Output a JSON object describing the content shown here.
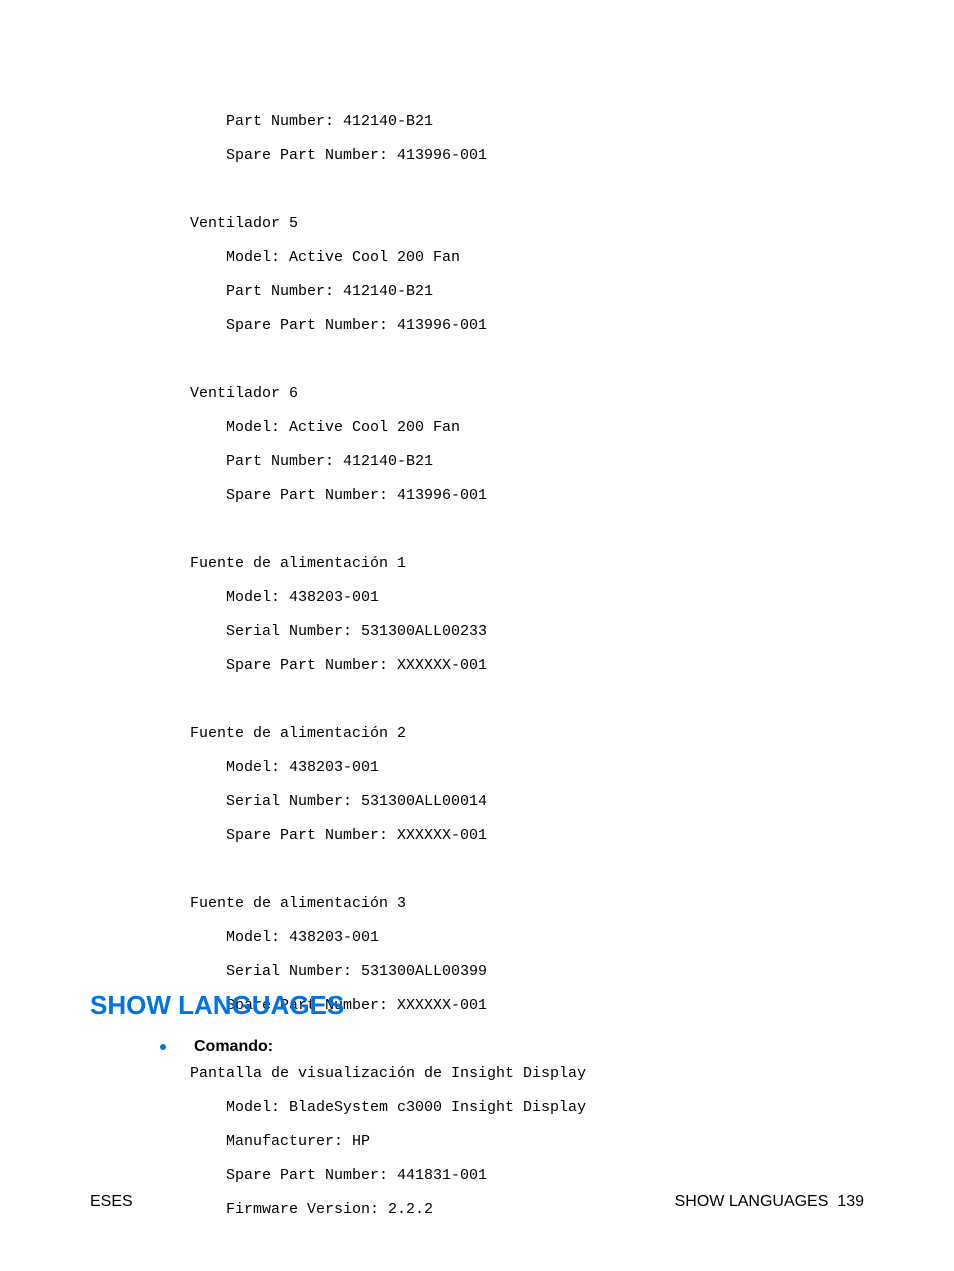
{
  "pre_block": {
    "orphan_lines": [
      "Part Number: 412140-B21",
      "Spare Part Number: 413996-001"
    ],
    "sections": [
      {
        "title": "Ventilador 5",
        "lines": [
          "Model: Active Cool 200 Fan",
          "Part Number: 412140-B21",
          "Spare Part Number: 413996-001"
        ]
      },
      {
        "title": "Ventilador 6",
        "lines": [
          "Model: Active Cool 200 Fan",
          "Part Number: 412140-B21",
          "Spare Part Number: 413996-001"
        ]
      },
      {
        "title": "Fuente de alimentación 1",
        "lines": [
          "Model: 438203-001",
          "Serial Number: 531300ALL00233",
          "Spare Part Number: XXXXXX-001"
        ]
      },
      {
        "title": "Fuente de alimentación 2",
        "lines": [
          "Model: 438203-001",
          "Serial Number: 531300ALL00014",
          "Spare Part Number: XXXXXX-001"
        ]
      },
      {
        "title": "Fuente de alimentación 3",
        "lines": [
          "Model: 438203-001",
          "Serial Number: 531300ALL00399",
          "Spare Part Number: XXXXXX-001"
        ]
      },
      {
        "title": "Pantalla de visualización de Insight Display",
        "lines": [
          "Model: BladeSystem c3000 Insight Display",
          "Manufacturer: HP",
          "Spare Part Number: 441831-001",
          "Firmware Version: 2.2.2"
        ]
      }
    ]
  },
  "heading": "SHOW LANGUAGES",
  "bullet_label": "Comando:",
  "footer": {
    "left": "ESES",
    "right_label": "SHOW LANGUAGES",
    "right_page": "139"
  }
}
